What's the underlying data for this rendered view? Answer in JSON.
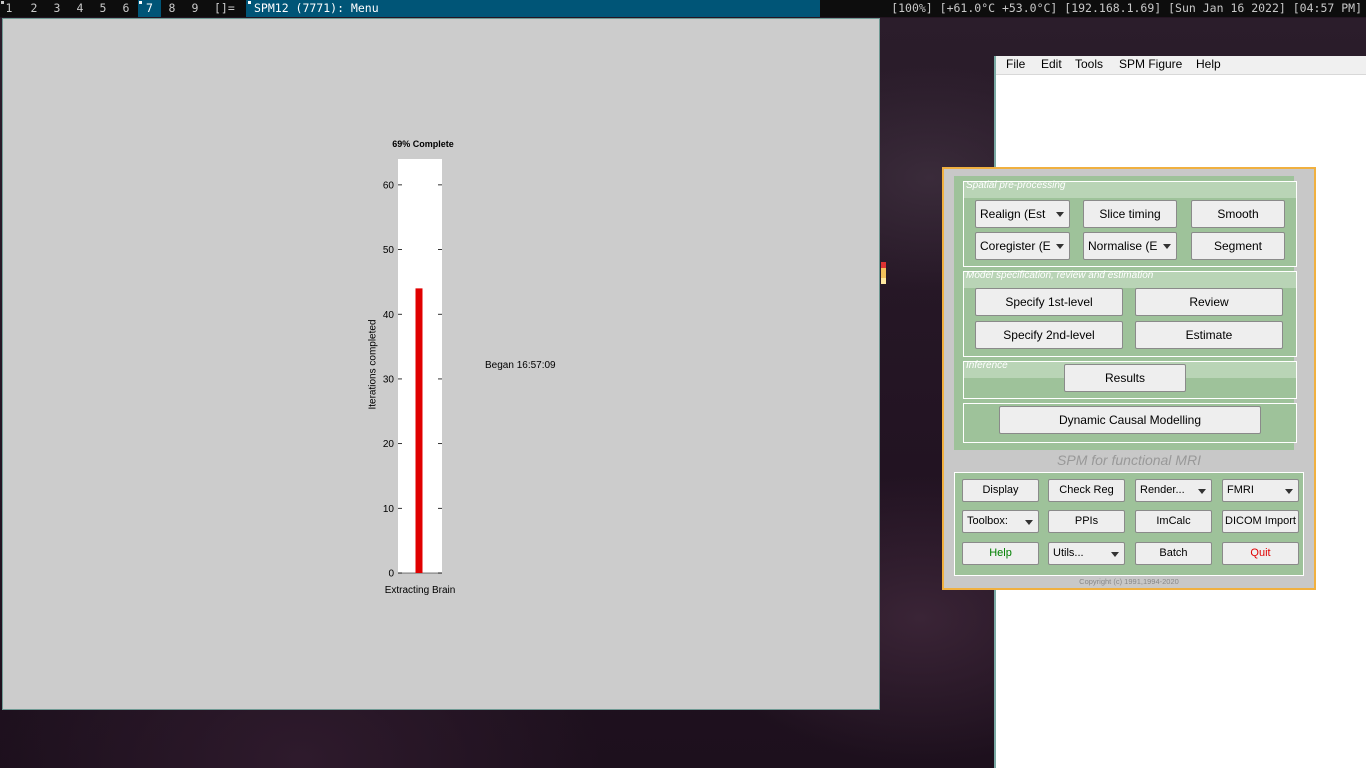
{
  "taskbar": {
    "tags": [
      "1",
      "2",
      "3",
      "4",
      "5",
      "6",
      "7",
      "8",
      "9"
    ],
    "active_tag": "7",
    "layout_symbol": "[]=",
    "window_title": "SPM12 (7771): Menu",
    "status": "[100%] [+61.0°C +53.0°C] [192.168.1.69] [Sun Jan 16 2022] [04:57 PM]"
  },
  "progress_window": {
    "title": "69% Complete",
    "xlabel": "Extracting Brain",
    "ylabel": "Iterations completed",
    "began": "Began 16:57:09"
  },
  "chart_data": {
    "type": "bar",
    "title": "69% Complete",
    "xlabel": "Extracting Brain",
    "ylabel": "Iterations completed",
    "categories": [
      ""
    ],
    "values": [
      44
    ],
    "ylim": [
      0,
      64
    ],
    "yticks": [
      0,
      10,
      20,
      30,
      40,
      50,
      60
    ],
    "bar_color": "#e00000",
    "grid": false
  },
  "menu_window": {
    "menubar": [
      "File",
      "Edit",
      "Tools",
      "SPM Figure",
      "Help"
    ]
  },
  "spm_panel": {
    "frames": {
      "spatial": "Spatial pre-processing",
      "model": "Model specification, review and estimation",
      "inference": "Inference"
    },
    "buttons": {
      "realign": "Realign (Est",
      "slice_timing": "Slice timing",
      "smooth": "Smooth",
      "coregister": "Coregister (E",
      "normalise": "Normalise (E",
      "segment": "Segment",
      "specify_1st": "Specify 1st-level",
      "review": "Review",
      "specify_2nd": "Specify 2nd-level",
      "estimate": "Estimate",
      "results": "Results",
      "dcm": "Dynamic Causal Modelling",
      "display": "Display",
      "check_reg": "Check Reg",
      "render": "Render...",
      "fmri": "FMRI",
      "toolbox": "Toolbox:",
      "ppis": "PPIs",
      "imcalc": "ImCalc",
      "dicom_import": "DICOM Import",
      "help": "Help",
      "utils": "Utils...",
      "batch": "Batch",
      "quit": "Quit"
    },
    "subtitle": "SPM for functional MRI",
    "copyright": "Copyright (c) 1991,1994-2020",
    "colors": {
      "help": "#008000",
      "quit": "#e00000",
      "panel_green": "#9ec29a",
      "border": "#f0b040"
    }
  }
}
